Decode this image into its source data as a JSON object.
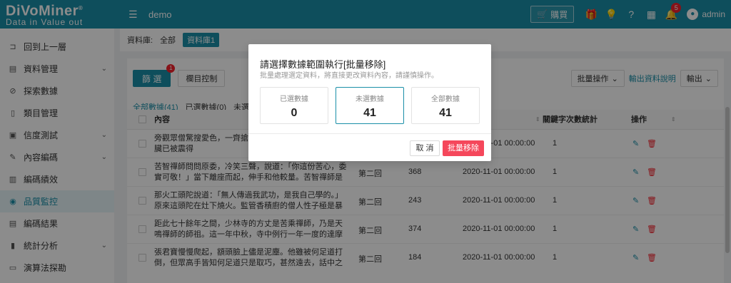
{
  "header": {
    "logo_main": "DiVoMiner",
    "logo_reg": "®",
    "logo_sub": "Data in  Value out",
    "project": "demo",
    "buy_label": "購買",
    "notification_count": "5",
    "user": "admin"
  },
  "sidebar": {
    "items": [
      {
        "label": "回到上一層",
        "icon": "back-icon"
      },
      {
        "label": "資料管理",
        "icon": "document-icon",
        "chevron": "⌄"
      },
      {
        "label": "探索數據",
        "icon": "explore-icon"
      },
      {
        "label": "類目管理",
        "icon": "category-icon"
      },
      {
        "label": "信度測試",
        "icon": "test-icon",
        "chevron": "⌄"
      },
      {
        "label": "內容編碼",
        "icon": "pen-icon",
        "chevron": "⌄"
      },
      {
        "label": "編碼績效",
        "icon": "performance-icon"
      },
      {
        "label": "品質監控",
        "icon": "eye-icon",
        "active": true
      },
      {
        "label": "編碼結果",
        "icon": "result-icon"
      },
      {
        "label": "統計分析",
        "icon": "chart-icon",
        "chevron": "⌄"
      },
      {
        "label": "演算法探勘",
        "icon": "algorithm-icon"
      }
    ]
  },
  "breadcrumb": {
    "label": "資料庫:",
    "all": "全部",
    "active": "資料庫1"
  },
  "toolbar": {
    "filter_label": "篩 選",
    "filter_badge": "1",
    "columns_label": "欄目控制",
    "batch_label": "批量操作",
    "export_desc": "輸出資料說明",
    "export_label": "輸出"
  },
  "counts": {
    "all": "全部數據(41)",
    "selected": "已選數據(0)",
    "unselected": "未選數據"
  },
  "table": {
    "col_content": "內容",
    "col_keyword": "關鍵字次數統計",
    "col_action": "操作",
    "rows": [
      {
        "text": "旁觀眾僧驚搜愛色，一齊搶上救護也說不出來，原來內臟已被震得",
        "chapter": "",
        "count": "",
        "date": "2020-11-01 00:00:00",
        "kw": "1"
      },
      {
        "text": "苦智禪師問問原委，冷笑三聲，說道：「你這份苦心，委實可敬！」當下離座而起，伸手和他較量。苦智禪師是少林寺高手",
        "chapter": "第二回",
        "count": "368",
        "date": "2020-11-01 00:00:00",
        "kw": "1"
      },
      {
        "text": "那火工頭陀說道：「無人傳過我武功，是我自己學的。」原來這頭陀在灶下燒火。監管香積廚的僧人性子極是暴躁，動不動提",
        "chapter": "第二回",
        "count": "243",
        "date": "2020-11-01 00:00:00",
        "kw": "1"
      },
      {
        "text": "距此七十餘年之間，少林寺的方丈是苦乘禪師，乃是天鳴禪師的師祖。這一年中秋，寺中例行一年一度的達摩堂大校，由方丈",
        "chapter": "第二回",
        "count": "374",
        "date": "2020-11-01 00:00:00",
        "kw": "1"
      },
      {
        "text": "張君寶慢慢爬起，額頭臉上儘是泥塵。他雖被何足道打倒，但眾高手皆知何足道只是取巧，甚然遠去，話中之意已說明不敢少",
        "chapter": "第二回",
        "count": "184",
        "date": "2020-11-01 00:00:00",
        "kw": "1"
      }
    ]
  },
  "modal": {
    "title": "請選擇數據範圍執行[批量移除]",
    "desc": "批量處理選定資料，將直接更改資料內容，請謹慎操作。",
    "stats": [
      {
        "label": "已選數據",
        "value": "0"
      },
      {
        "label": "未選數據",
        "value": "41"
      },
      {
        "label": "全部數據",
        "value": "41"
      }
    ],
    "cancel_label": "取 消",
    "confirm_label": "批量移除"
  },
  "colors": {
    "brand": "#1a8fa8",
    "danger": "#f5475b"
  }
}
